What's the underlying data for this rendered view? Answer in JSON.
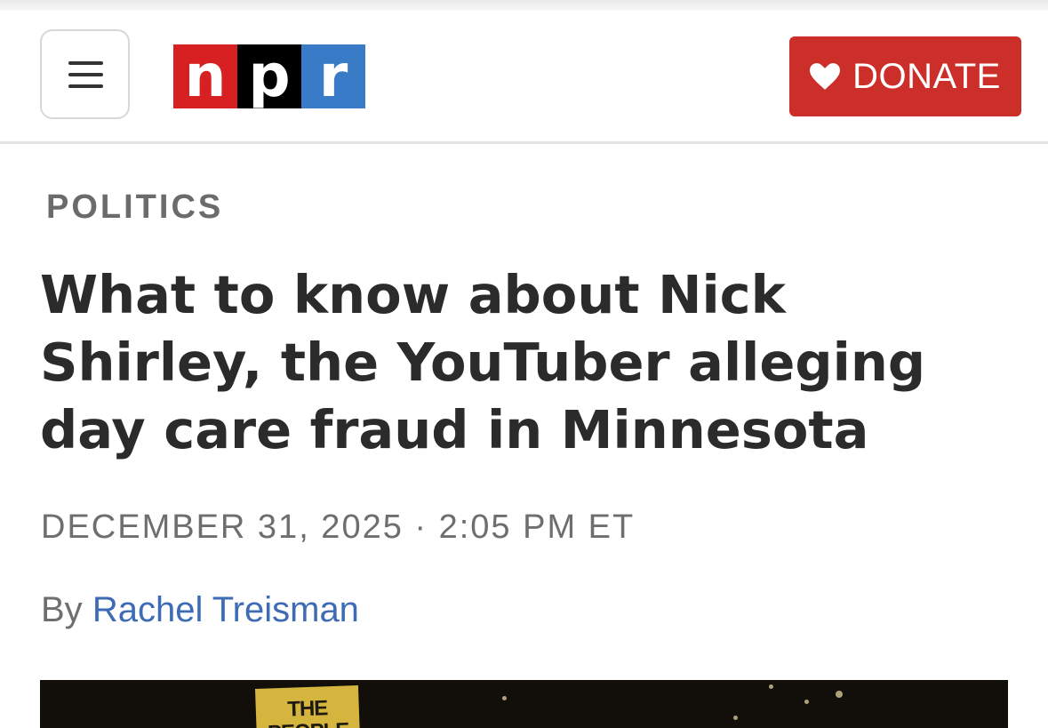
{
  "header": {
    "menu_icon": "hamburger-menu-icon",
    "logo": {
      "letters": [
        "n",
        "p",
        "r"
      ],
      "colors": [
        "#d62021",
        "#000000",
        "#3a7bc8"
      ]
    },
    "donate": {
      "label": "DONATE",
      "icon": "heart-icon",
      "color": "#cc2f2a"
    }
  },
  "article": {
    "section": "POLITICS",
    "headline": "What to know about Nick Shirley, the YouTuber alleging day care fraud in Minnesota",
    "dateline": "DECEMBER 31, 2025 · 2:05 PM ET",
    "byline_prefix": "By",
    "author": "Rachel Treisman",
    "hero_sign_text": "THE PEOPLE"
  }
}
